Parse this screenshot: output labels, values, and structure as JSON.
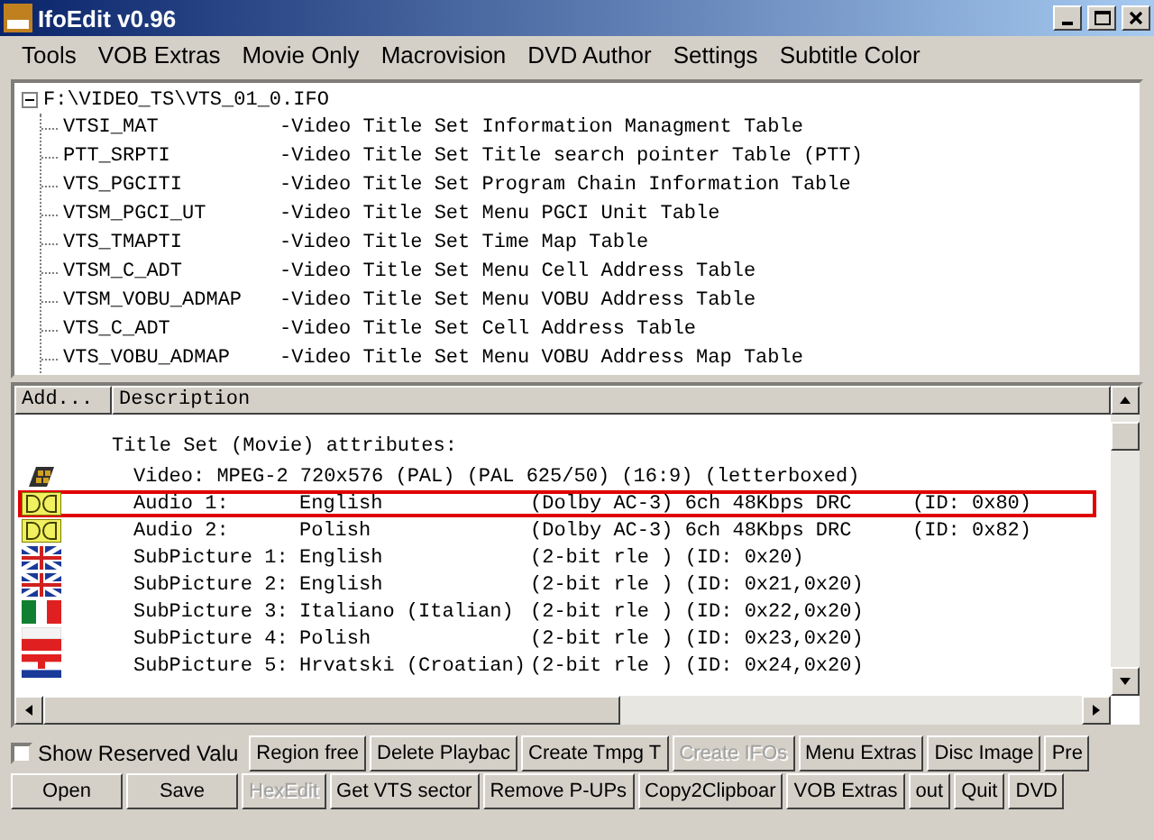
{
  "window": {
    "title": "IfoEdit v0.96"
  },
  "menu": [
    "Tools",
    "VOB Extras",
    "Movie Only",
    "Macrovision",
    "DVD Author",
    "Settings",
    "Subtitle Color"
  ],
  "tree": {
    "label": "F:\\VIDEO_TS\\VTS_01_0.IFO",
    "expanded": true,
    "children": [
      {
        "name": "VTSI_MAT",
        "description": "-Video Title Set Information Managment Table"
      },
      {
        "name": "PTT_SRPTI",
        "description": "-Video Title Set Title search pointer Table (PTT)"
      },
      {
        "name": "VTS_PGCITI",
        "description": "-Video Title Set Program Chain Information Table"
      },
      {
        "name": "VTSM_PGCI_UT",
        "description": "-Video Title Set Menu PGCI Unit Table"
      },
      {
        "name": "VTS_TMAPTI",
        "description": "-Video Title Set Time Map Table"
      },
      {
        "name": "VTSM_C_ADT",
        "description": "-Video Title Set Menu Cell Address Table"
      },
      {
        "name": "VTSM_VOBU_ADMAP",
        "description": "-Video Title Set Menu VOBU Address Table"
      },
      {
        "name": "VTS_C_ADT",
        "description": "-Video Title Set Cell Address Table"
      },
      {
        "name": "VTS_VOBU_ADMAP",
        "description": "-Video Title Set Menu VOBU Address Map Table"
      }
    ]
  },
  "list": {
    "add_button": "Add...",
    "description_header": "Description",
    "heading": "Title Set (Movie) attributes:",
    "rows": [
      {
        "kind": "film",
        "highlighted": false,
        "cells": [
          "Video: MPEG-2 720x576 (PAL) (PAL 625/50) (16:9) (letterboxed)"
        ]
      },
      {
        "kind": "audio",
        "highlighted": true,
        "cells": [
          "Audio 1:",
          "English",
          "(Dolby AC-3) 6ch 48Kbps DRC",
          "(ID: 0x80)"
        ]
      },
      {
        "kind": "audio",
        "highlighted": false,
        "cells": [
          "Audio 2:",
          "Polish",
          "(Dolby AC-3) 6ch 48Kbps DRC",
          "(ID: 0x82)"
        ]
      },
      {
        "kind": "flag-uk",
        "highlighted": false,
        "cells": [
          "SubPicture 1:",
          "English",
          "(2-bit rle ) (ID: 0x20)"
        ]
      },
      {
        "kind": "flag-uk",
        "highlighted": false,
        "cells": [
          "SubPicture 2:",
          "English",
          "(2-bit rle ) (ID: 0x21,0x20)"
        ]
      },
      {
        "kind": "flag-it",
        "highlighted": false,
        "cells": [
          "SubPicture 3:",
          "Italiano (Italian)",
          "(2-bit rle ) (ID: 0x22,0x20)"
        ]
      },
      {
        "kind": "flag-pl",
        "highlighted": false,
        "cells": [
          "SubPicture 4:",
          "Polish",
          "(2-bit rle ) (ID: 0x23,0x20)"
        ]
      },
      {
        "kind": "flag-hr",
        "highlighted": false,
        "cells": [
          "SubPicture 5:",
          "Hrvatski (Croatian)",
          "(2-bit rle ) (ID: 0x24,0x20)"
        ]
      }
    ]
  },
  "checkbox": {
    "label": "Show Reserved Valu",
    "checked": false
  },
  "buttons_row_1": [
    {
      "label": "Region free",
      "disabled": false
    },
    {
      "label": "Delete Playbac",
      "disabled": false
    },
    {
      "label": "Create Tmpg T",
      "disabled": false
    },
    {
      "label": "Create IFOs",
      "disabled": true
    },
    {
      "label": "Menu Extras",
      "disabled": false
    },
    {
      "label": "Disc Image",
      "disabled": false
    },
    {
      "label": "Pre",
      "disabled": false
    }
  ],
  "buttons_row_2": [
    {
      "label": "Open",
      "disabled": false
    },
    {
      "label": "Save",
      "disabled": false
    },
    {
      "label": "HexEdit",
      "disabled": true
    },
    {
      "label": "Get VTS sector",
      "disabled": false
    },
    {
      "label": "Remove P-UPs",
      "disabled": false
    },
    {
      "label": "Copy2Clipboar",
      "disabled": false
    },
    {
      "label": "VOB Extras",
      "disabled": false
    },
    {
      "label": "out",
      "disabled": false
    },
    {
      "label": "Quit",
      "disabled": false
    },
    {
      "label": "DVD",
      "disabled": false
    }
  ]
}
